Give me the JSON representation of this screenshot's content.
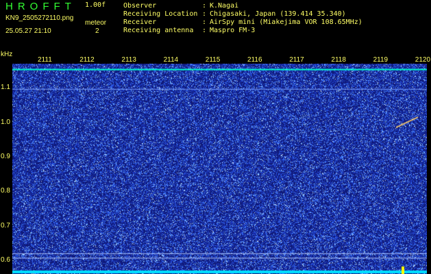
{
  "header": {
    "logo": "HROFFT",
    "version": "1.00f",
    "filename": "KN9_2505272110.png",
    "meteor_label": "meteor",
    "meteor_count": "2",
    "datetime": "25.05.27 21:10",
    "fields": [
      {
        "label": "Observer",
        "value": "K.Nagai"
      },
      {
        "label": "Receiving Location",
        "value": "Chigasaki, Japan (139.414 35.340)"
      },
      {
        "label": "Receiver",
        "value": "AirSpy mini (Miakejima VOR 108.65MHz)"
      },
      {
        "label": "Receiving antenna",
        "value": "Maspro FM-3"
      }
    ]
  },
  "chart_data": {
    "type": "heatmap",
    "ylabel": "kHz",
    "x_ticks": [
      "2111",
      "2112",
      "2113",
      "2114",
      "2115",
      "2116",
      "2117",
      "2118",
      "2119",
      "2120"
    ],
    "y_ticks": [
      "1.1",
      "1.0",
      "0.9",
      "0.8",
      "0.7",
      "0.6"
    ],
    "ylim": [
      0.56,
      1.17
    ],
    "colors": {
      "background": "#101a7a",
      "noise": "#4a7dff",
      "signal": "#00ffcc",
      "label": "#ffff66"
    }
  }
}
